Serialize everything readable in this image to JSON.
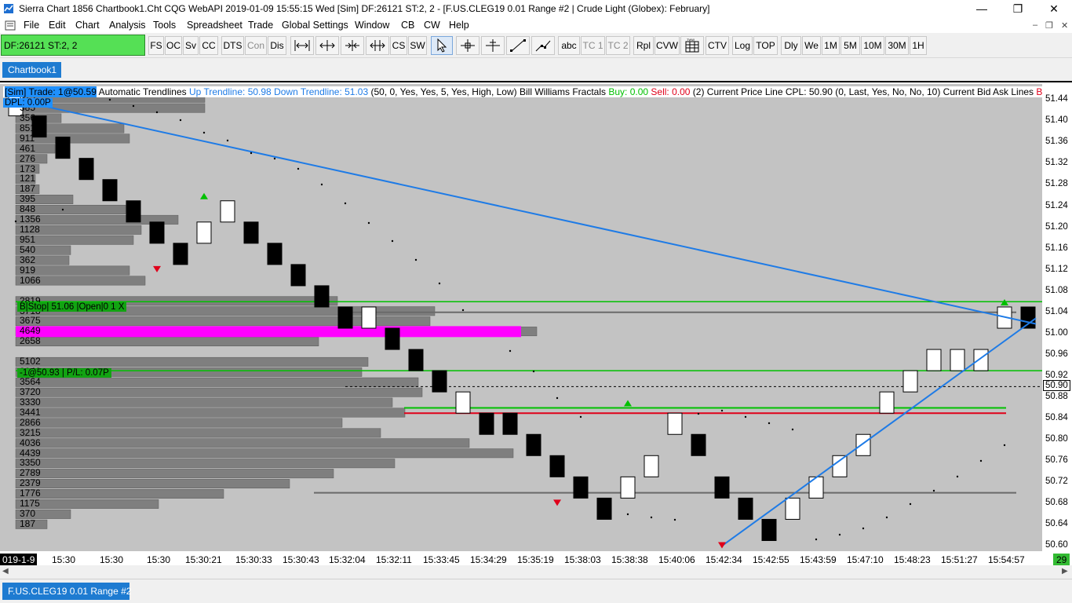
{
  "window": {
    "title": "Sierra Chart 1856 Chartbook1.Cht  CQG WebAPI 2019-01-09  15:55:15 Wed [Sim]  DF:26121  ST:2, 2 - [F.US.CLEG19  0.01 Range  #2 | Crude Light (Globex): February]",
    "minimize_icon": "minimize-icon",
    "restore_icon": "restore-icon",
    "close_icon": "close-icon"
  },
  "menu": {
    "items": [
      "File",
      "Edit",
      "Chart",
      "Analysis",
      "Tools",
      "Spreadsheet",
      "Trade",
      "Global Settings",
      "Window",
      "CB",
      "CW",
      "Help"
    ]
  },
  "toolbar": {
    "df_label": "DF:26121  ST:2, 2",
    "buttons": [
      "FS",
      "OC",
      "Sv",
      "CC",
      "DTS",
      "Con",
      "Dis",
      "CS",
      "SW",
      "abc",
      "TC 1",
      "TC 2",
      "Rpl",
      "CVW",
      "CTV",
      "Log",
      "TOP",
      "Dly",
      "We",
      "1M",
      "5M",
      "10M",
      "30M",
      "1H"
    ]
  },
  "tabs": {
    "chartbook": "Chartbook1",
    "bottom": "F.US.CLEG19  0.01 Range  #2"
  },
  "studies": {
    "sim_trade": "[Sim]  Trade: 1@50.59",
    "trendlines": "Automatic Trendlines",
    "up_trendline": "Up Trendline: 50.98",
    "down_trendline": "Down Trendline: 51.03",
    "params1": "(50, 0, Yes, Yes, 5, Yes, High, Low)",
    "fractals": "Bill Williams Fractals",
    "buy": "Buy: 0.00",
    "sell": "Sell: 0.00",
    "params2": "(2)",
    "cpl_name": "Current Price Line",
    "cpl": "CPL: 50.90",
    "params3": "(0, Last, Yes, No, No, 10)",
    "bidask": "Current Bid Ask Lines",
    "bidask_cut": "Bi",
    "dpl": "DPL: 0.00P"
  },
  "orders": {
    "stop": "B|Stop| 51.06 |Open|0  1   X",
    "position": "-1@50.93 | P/L: 0.07P"
  },
  "colors": {
    "plot_bg": "#c3c3c3",
    "up_trendline": "#1e7be6",
    "down_trendline": "#1e7be6",
    "order_line": "#00c000",
    "bid_line": "#e0001a",
    "poc": "#ff00ff",
    "profile_bar": "#7f7f7f"
  },
  "volume_profile": {
    "labels": [
      "675",
      "385",
      "356",
      "851",
      "911",
      "461",
      "276",
      "173",
      "121",
      "187",
      "395",
      "848",
      "1356",
      "1128",
      "951",
      "540",
      "362",
      "919",
      "1066",
      "",
      "2819",
      "3718",
      "3675",
      "4649",
      "2658",
      "",
      "5102",
      "3046",
      "3564",
      "3720",
      "3330",
      "3441",
      "2866",
      "3215",
      "4036",
      "4439",
      "3350",
      "2789",
      "2379",
      "1776",
      "1175",
      "370",
      "187"
    ]
  },
  "y_axis": {
    "ticks": [
      "51.44",
      "51.40",
      "51.36",
      "51.32",
      "51.28",
      "51.24",
      "51.20",
      "51.16",
      "51.12",
      "51.08",
      "51.04",
      "51.00",
      "50.96",
      "50.92",
      "50.88",
      "50.84",
      "50.80",
      "50.76",
      "50.72",
      "50.68",
      "50.64",
      "50.60"
    ],
    "current_price": "50.90"
  },
  "x_axis": {
    "date": "019-1-9",
    "ticks": [
      "15:30",
      "15:30",
      "15:30",
      "15:30:21",
      "15:30:33",
      "15:30:43",
      "15:32:04",
      "15:32:11",
      "15:33:45",
      "15:34:29",
      "15:35:19",
      "15:38:03",
      "15:38:38",
      "15:40:06",
      "15:42:34",
      "15:42:55",
      "15:43:59",
      "15:47:10",
      "15:48:23",
      "15:51:27",
      "15:54:57"
    ],
    "badge": "29"
  },
  "chart_data": {
    "type": "renko",
    "instrument": "F.US.CLEG19",
    "brick_size": 0.04,
    "bars": [
      {
        "dir": "up",
        "top": 51.45,
        "bottom": 51.41
      },
      {
        "dir": "down",
        "top": 51.41,
        "bottom": 51.37
      },
      {
        "dir": "down",
        "top": 51.37,
        "bottom": 51.33
      },
      {
        "dir": "down",
        "top": 51.33,
        "bottom": 51.29
      },
      {
        "dir": "down",
        "top": 51.29,
        "bottom": 51.25
      },
      {
        "dir": "down",
        "top": 51.25,
        "bottom": 51.21
      },
      {
        "dir": "down",
        "top": 51.21,
        "bottom": 51.17
      },
      {
        "dir": "down",
        "top": 51.17,
        "bottom": 51.13
      },
      {
        "dir": "up",
        "top": 51.21,
        "bottom": 51.17
      },
      {
        "dir": "up",
        "top": 51.25,
        "bottom": 51.21
      },
      {
        "dir": "down",
        "top": 51.21,
        "bottom": 51.17
      },
      {
        "dir": "down",
        "top": 51.17,
        "bottom": 51.13
      },
      {
        "dir": "down",
        "top": 51.13,
        "bottom": 51.09
      },
      {
        "dir": "down",
        "top": 51.09,
        "bottom": 51.05
      },
      {
        "dir": "down",
        "top": 51.05,
        "bottom": 51.01
      },
      {
        "dir": "up",
        "top": 51.05,
        "bottom": 51.01
      },
      {
        "dir": "down",
        "top": 51.01,
        "bottom": 50.97
      },
      {
        "dir": "down",
        "top": 50.97,
        "bottom": 50.93
      },
      {
        "dir": "down",
        "top": 50.93,
        "bottom": 50.89
      },
      {
        "dir": "up",
        "top": 50.89,
        "bottom": 50.85
      },
      {
        "dir": "down",
        "top": 50.85,
        "bottom": 50.81
      },
      {
        "dir": "down",
        "top": 50.85,
        "bottom": 50.81
      },
      {
        "dir": "down",
        "top": 50.81,
        "bottom": 50.77
      },
      {
        "dir": "down",
        "top": 50.77,
        "bottom": 50.73
      },
      {
        "dir": "down",
        "top": 50.73,
        "bottom": 50.69
      },
      {
        "dir": "down",
        "top": 50.69,
        "bottom": 50.65
      },
      {
        "dir": "up",
        "top": 50.73,
        "bottom": 50.69
      },
      {
        "dir": "up",
        "top": 50.77,
        "bottom": 50.73
      },
      {
        "dir": "up",
        "top": 50.85,
        "bottom": 50.81
      },
      {
        "dir": "down",
        "top": 50.81,
        "bottom": 50.77
      },
      {
        "dir": "down",
        "top": 50.73,
        "bottom": 50.69
      },
      {
        "dir": "down",
        "top": 50.69,
        "bottom": 50.65
      },
      {
        "dir": "down",
        "top": 50.65,
        "bottom": 50.61
      },
      {
        "dir": "up",
        "top": 50.69,
        "bottom": 50.65
      },
      {
        "dir": "up",
        "top": 50.73,
        "bottom": 50.69
      },
      {
        "dir": "up",
        "top": 50.77,
        "bottom": 50.73
      },
      {
        "dir": "up",
        "top": 50.81,
        "bottom": 50.77
      },
      {
        "dir": "up",
        "top": 50.89,
        "bottom": 50.85
      },
      {
        "dir": "up",
        "top": 50.93,
        "bottom": 50.89
      },
      {
        "dir": "up",
        "top": 50.97,
        "bottom": 50.93
      },
      {
        "dir": "up",
        "top": 50.97,
        "bottom": 50.93
      },
      {
        "dir": "up",
        "top": 50.97,
        "bottom": 50.93
      },
      {
        "dir": "up",
        "top": 51.05,
        "bottom": 51.01
      },
      {
        "dir": "down",
        "top": 51.05,
        "bottom": 51.01
      },
      {
        "dir": "down",
        "top": 50.93,
        "bottom": 50.89
      }
    ],
    "trendlines": [
      {
        "name": "Down Trendline",
        "from": {
          "bar": 0,
          "price": 51.44
        },
        "to": {
          "bar": 42,
          "price": 51.03
        }
      },
      {
        "name": "Up Trendline",
        "from": {
          "bar": 30,
          "price": 50.6
        },
        "to": {
          "bar": 42,
          "price": 50.98
        }
      }
    ],
    "horizontal_lines": [
      {
        "name": "order-stop",
        "price": 51.06
      },
      {
        "name": "position",
        "price": 50.93
      },
      {
        "name": "current-price",
        "price": 50.9
      },
      {
        "name": "bid",
        "price": 50.86
      },
      {
        "name": "ask",
        "price": 50.85
      },
      {
        "name": "level-high",
        "price": 51.04
      },
      {
        "name": "level-low",
        "price": 50.7
      }
    ],
    "ylim": [
      50.59,
      51.47
    ]
  }
}
